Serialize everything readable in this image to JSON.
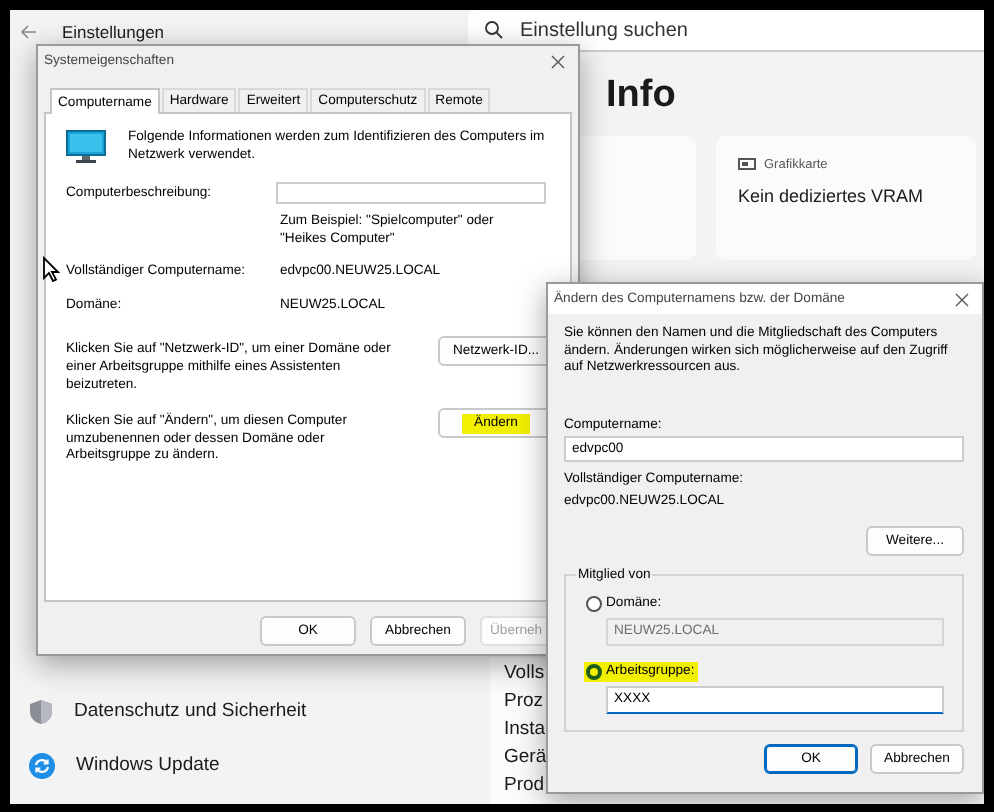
{
  "settings": {
    "title": "Einstellungen",
    "search": {
      "placeholder": "Einstellung suchen"
    },
    "heading": "Info",
    "card": {
      "label": "Grafikkarte",
      "value": "Kein dediziertes VRAM"
    },
    "nav_items": [
      {
        "label": "Datenschutz und Sicherheit",
        "kind": "shield"
      },
      {
        "label": "Windows Update",
        "kind": "update"
      }
    ],
    "spec_labels": [
      "Volls",
      "Proz",
      "Insta",
      "Gerä",
      "Prod"
    ]
  },
  "system_properties": {
    "title": "Systemeigenschaften",
    "tabs": [
      {
        "label": "Computername",
        "selected": true
      },
      {
        "label": "Hardware",
        "selected": false
      },
      {
        "label": "Erweitert",
        "selected": false
      },
      {
        "label": "Computerschutz",
        "selected": false
      },
      {
        "label": "Remote",
        "selected": false
      }
    ],
    "intro": "Folgende Informationen werden zum Identifizieren des Computers im Netzwerk verwendet.",
    "description_label": "Computerbeschreibung:",
    "example": "Zum Beispiel: \"Spielcomputer\" oder \"Heikes Computer\"",
    "fields": [
      {
        "label": "Vollständiger Computername:",
        "value": "edvpc00.NEUW25.LOCAL"
      },
      {
        "label": "Domäne:",
        "value": "NEUW25.LOCAL"
      }
    ],
    "actions": [
      {
        "text": "Klicken Sie auf \"Netzwerk-ID\", um einer Domäne oder einer Arbeitsgruppe mithilfe eines Assistenten beizutreten.",
        "button": "Netzwerk-ID...",
        "highlighted": false
      },
      {
        "text": "Klicken Sie auf \"Ändern\", um diesen Computer umzubenennen oder dessen Domäne oder Arbeitsgruppe zu ändern.",
        "button": "Ändern",
        "highlighted": true
      }
    ],
    "buttons": [
      {
        "label": "OK",
        "disabled": false
      },
      {
        "label": "Abbrechen",
        "disabled": false
      },
      {
        "label": "Überneh",
        "disabled": true
      }
    ]
  },
  "change_dialog": {
    "title": "Ändern des Computernamens bzw. der Domäne",
    "intro": "Sie können den Namen und die Mitgliedschaft des Computers ändern. Änderungen wirken sich möglicherweise auf den Zugriff auf Netzwerkressourcen aus.",
    "name_label": "Computername:",
    "name_value": "edvpc00",
    "full_label": "Vollständiger Computername:",
    "full_value": "edvpc00.NEUW25.LOCAL",
    "more_button": "Weitere...",
    "member_group": {
      "title": "Mitglied von",
      "options": [
        {
          "label": "Domäne:",
          "selected": false,
          "highlighted": false,
          "value": "NEUW25.LOCAL"
        },
        {
          "label": "Arbeitsgruppe:",
          "selected": true,
          "highlighted": true,
          "value": "XXXX"
        }
      ]
    },
    "buttons": [
      {
        "label": "OK",
        "default": true
      },
      {
        "label": "Abbrechen",
        "default": false
      }
    ]
  }
}
